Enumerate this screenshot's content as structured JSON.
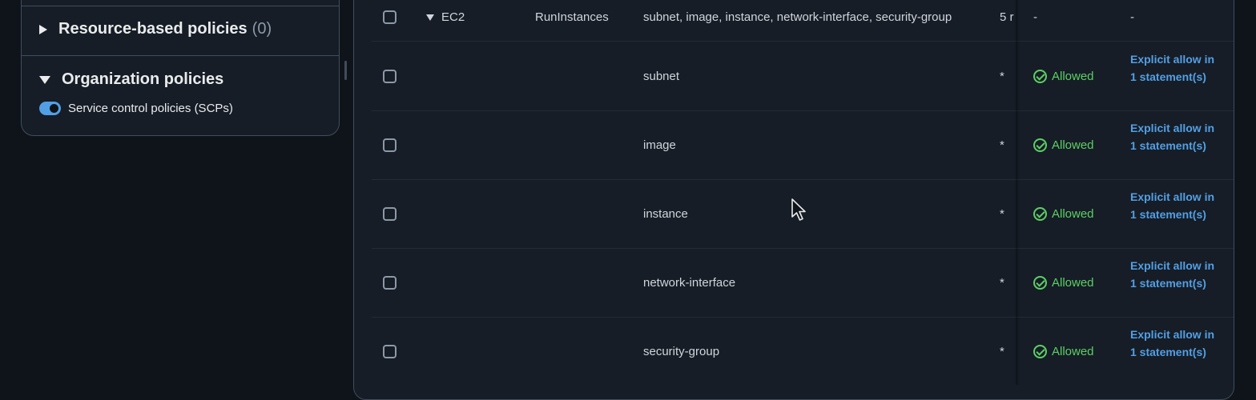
{
  "left_panel": {
    "resource_policies": {
      "label": "Resource-based policies",
      "count": "(0)"
    },
    "organization_policies": {
      "label": "Organization policies"
    },
    "scp_toggle": {
      "label": "Service control policies (SCPs)",
      "enabled": true
    }
  },
  "table": {
    "parent_row": {
      "service": "EC2",
      "action": "RunInstances",
      "resource_type": "subnet, image, instance, network-interface, security-group",
      "resources_truncated": "5 r",
      "decision": "-",
      "details": "-"
    },
    "rows": [
      {
        "resource_type": "subnet",
        "resource": "*",
        "decision": "Allowed",
        "details": "Explicit allow in 1 statement(s)"
      },
      {
        "resource_type": "image",
        "resource": "*",
        "decision": "Allowed",
        "details": "Explicit allow in 1 statement(s)"
      },
      {
        "resource_type": "instance",
        "resource": "*",
        "decision": "Allowed",
        "details": "Explicit allow in 1 statement(s)"
      },
      {
        "resource_type": "network-interface",
        "resource": "*",
        "decision": "Allowed",
        "details": "Explicit allow in 1 statement(s)"
      },
      {
        "resource_type": "security-group",
        "resource": "*",
        "decision": "Allowed",
        "details": "Explicit allow in 1 statement(s)"
      }
    ]
  },
  "colors": {
    "allowed": "#5dcf65",
    "link": "#539fe5",
    "panel": "#161d26",
    "background": "#0f141a"
  }
}
